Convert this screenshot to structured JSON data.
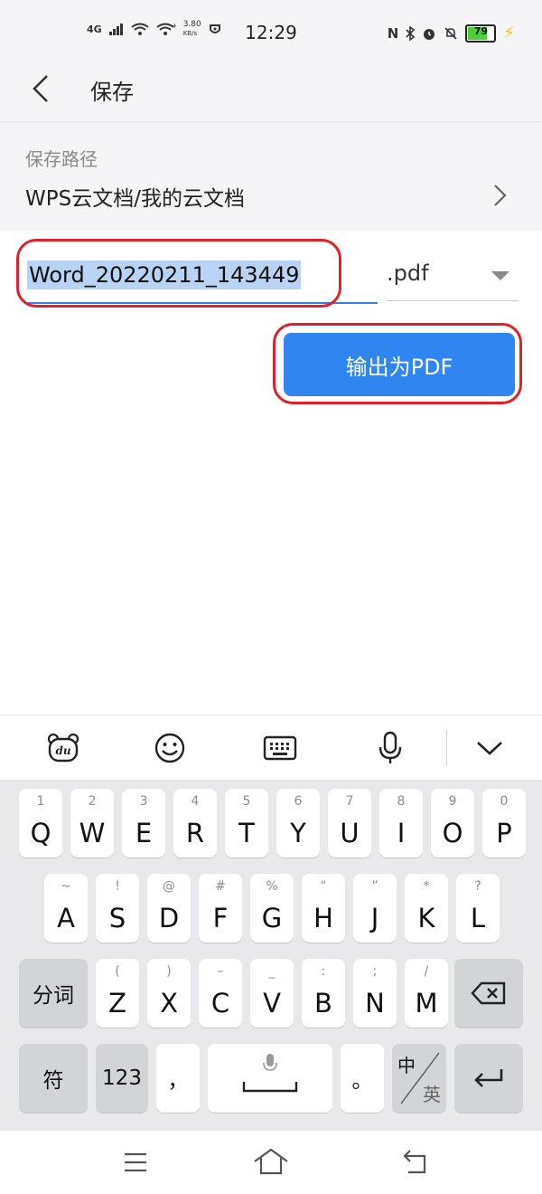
{
  "status_bar": {
    "network": "4G",
    "speed_value": "3.80",
    "speed_unit": "KB/s",
    "time": "12:29",
    "battery": "79",
    "battery_level": 0.79
  },
  "header": {
    "title": "保存"
  },
  "save_path": {
    "label": "保存路径",
    "value": "WPS云文档/我的云文档"
  },
  "filename": {
    "value": "Word_20220211_143449",
    "extension": ".pdf"
  },
  "export_button": {
    "label": "输出为PDF"
  },
  "keyboard": {
    "toolbar_icons": [
      "baidu-du-icon",
      "emoji-icon",
      "keyboard-icon",
      "microphone-icon",
      "collapse-chevron-icon"
    ],
    "row1": [
      {
        "sub": "1",
        "main": "Q"
      },
      {
        "sub": "2",
        "main": "W"
      },
      {
        "sub": "3",
        "main": "E"
      },
      {
        "sub": "4",
        "main": "R"
      },
      {
        "sub": "5",
        "main": "T"
      },
      {
        "sub": "6",
        "main": "Y"
      },
      {
        "sub": "7",
        "main": "U"
      },
      {
        "sub": "8",
        "main": "I"
      },
      {
        "sub": "9",
        "main": "O"
      },
      {
        "sub": "0",
        "main": "P"
      }
    ],
    "row2": [
      {
        "sub": "~",
        "main": "A"
      },
      {
        "sub": "!",
        "main": "S"
      },
      {
        "sub": "@",
        "main": "D"
      },
      {
        "sub": "#",
        "main": "F"
      },
      {
        "sub": "%",
        "main": "G"
      },
      {
        "sub": "“",
        "main": "H"
      },
      {
        "sub": "”",
        "main": "J"
      },
      {
        "sub": "*",
        "main": "K"
      },
      {
        "sub": "?",
        "main": "L"
      }
    ],
    "row3": [
      {
        "sub": "(",
        "main": "Z"
      },
      {
        "sub": ")",
        "main": "X"
      },
      {
        "sub": "–",
        "main": "C"
      },
      {
        "sub": "_",
        "main": "V"
      },
      {
        "sub": ":",
        "main": "B"
      },
      {
        "sub": ";",
        "main": "N"
      },
      {
        "sub": "/",
        "main": "M"
      }
    ],
    "fenci": "分词",
    "fu": "符",
    "num": "123",
    "comma": "，",
    "period": "。",
    "zh": "中",
    "en": "英"
  },
  "colors": {
    "accent": "#2f86f0",
    "highlight": "#b9d3f5",
    "annotation": "#e0202a"
  }
}
